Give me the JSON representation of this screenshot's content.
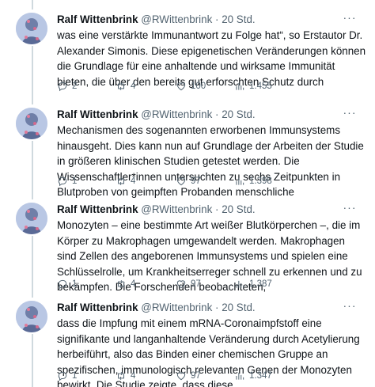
{
  "tweets": [
    {
      "name": "Ralf Wittenbrink",
      "handle": "@RWittenbrink",
      "time": "· 20 Std.",
      "more": "···",
      "text": "was eine verstärkte Immunantwort zu Folge hat“, so Erstautor Dr. Alexander Simonis. Diese epigenetischen Veränderungen können die Grundlage für eine anhaltende und wirksame Immunität bieten, die über den bereits gut erforschten Schutz durch",
      "replies": "2",
      "retweets": "4",
      "likes": "100",
      "views": "1.455"
    },
    {
      "name": "Ralf Wittenbrink",
      "handle": "@RWittenbrink",
      "time": "· 20 Std.",
      "more": "···",
      "text": "Mechanismen des sogenannten erworbenen Immunsystems hinausgeht. Dies kann nun auf Grundlage der Arbeiten der Studie in größeren klinischen Studien getestet werden. Die Wissenschaftler*innen untersuchten zu sechs Zeitpunkten in Blutproben von geimpften Probanden menschliche",
      "replies": "1",
      "retweets": "4",
      "likes": "97",
      "views": "1.398"
    },
    {
      "name": "Ralf Wittenbrink",
      "handle": "@RWittenbrink",
      "time": "· 20 Std.",
      "more": "···",
      "text": "Monozyten – eine bestimmte Art weißer Blutkörperchen –, die im Körper zu Makrophagen umgewandelt werden. Makrophagen sind Zellen des angeborenen Immunsystems und spielen eine Schlüsselrolle, um Krankheitserreger schnell zu erkennen und zu bekämpfen. Die Forschenden beobachteten,",
      "replies": "1",
      "retweets": "4",
      "likes": "97",
      "views": "1.387"
    },
    {
      "name": "Ralf Wittenbrink",
      "handle": "@RWittenbrink",
      "time": "· 20 Std.",
      "more": "···",
      "text": "dass die Impfung mit einem mRNA-Coronaimpfstoff eine signifikante und langanhaltende Veränderung durch Acetylierung herbeiführt, also das Binden einer chemischen Gruppe an spezifischen, immunologisch relevanten Genen der Monozyten bewirkt. Die Studie zeigte, dass diese",
      "replies": "1",
      "retweets": "4",
      "likes": "97",
      "views": "1.347"
    }
  ],
  "icons": {
    "reply": "reply-icon",
    "retweet": "retweet-icon",
    "like": "heart-icon",
    "views": "views-icon",
    "bookmark": "bookmark-icon",
    "share": "share-icon"
  },
  "colors": {
    "text": "#0f1419",
    "muted": "#536471",
    "thread_line": "#cfd9de",
    "avatar_bg": "#c4cfe6"
  }
}
